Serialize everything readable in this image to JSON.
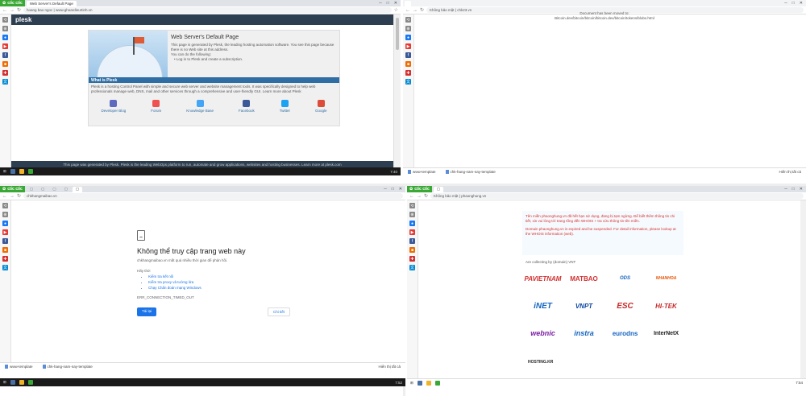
{
  "browser": {
    "brand": "cốc cốc"
  },
  "panel1": {
    "tab": "Web Server's Default Page",
    "address": "hoang bao ngoc | www.ghoardieurtinh.vn",
    "plesk_logo": "plesk",
    "title": "Web Server's Default Page",
    "description": "This page is generated by Plesk, the leading hosting automation software. You see this page because there is no Web site at this address.",
    "bullet_intro": "You can do the following:",
    "bullet": "Log in to Plesk and create a subscription.",
    "whatis_heading": "What is Plesk",
    "whatis_text": "Plesk is a hosting Control Panel with simple and secure web server and website management tools. It was specifically designed to help web professionals manage web, DNS, mail and other services through a comprehensive and user-friendly GUI. Learn more about Plesk",
    "links": [
      "Developer Blog",
      "Forum",
      "Knowledge Base",
      "Facebook",
      "Twitter",
      "Google"
    ],
    "footer": "This page was generated by Plesk. Plesk is the leading WebOps platform to run, automate and grow applications, websites and hosting businesses. Learn more at plesk.com",
    "taskbar_time": "7:40"
  },
  "panel2": {
    "tab": "",
    "address": "Không bảo mật | chk23.vn",
    "line1": "Document has been moved to:",
    "line2": "Bitcoin.dev/bitcoin/bitcoin/bitcoin.dev/bitcoin/tokens/blobs.html",
    "downloads": [
      "www-template",
      "chk-hang-nam-nay-template"
    ],
    "show_all": "Hiển thị tất cả"
  },
  "panel3": {
    "address": "chkhangmaibao.vn",
    "title": "Không thể truy cập trang web này",
    "subtitle": "chkhangmaibao.vn mất quá nhiều thời gian để phản hồi.",
    "try_label": "Hãy thử:",
    "suggestions": [
      "Kiểm tra kết nối",
      "Kiểm tra proxy và tường lửa",
      "Chạy Chẩn đoán mạng Windows"
    ],
    "error_code": "ERR_CONNECTION_TIMED_OUT",
    "reload": "Tải lại",
    "details": "Chi tiết",
    "downloads": [
      "www-template",
      "chk-hang-nam-nay-template"
    ],
    "show_all": "Hiển thị tất cả",
    "taskbar_time": "7:52"
  },
  "panel4": {
    "address": "Không bảo mật | phaonghung.vn",
    "notice_vi": "Tên miền phaonghung.vn đã hết hạn sử dụng, đang bị tạm ngừng. Để biết thêm thông tin chi tiết, xin vui lòng tới trang tống đến WHOIS + tra cứu thông tin tên miền.",
    "notice_en": "Domain phaonghung.vn is expired and be suspended. For detail information, please lookup at the WHOIS information (web).",
    "provided_by": "Are collecting by (domain) VNT",
    "logos": [
      "PAVIETNAM",
      "MATBAO",
      "ODS",
      "NHANHOA",
      "iNET",
      "VNPT",
      "ESC",
      "HI-TEK",
      "webnic",
      "instra",
      "eurodns",
      "InterNetX"
    ],
    "hosting": "HOSTING.KR",
    "taskbar_time": "7:54"
  },
  "colors": {
    "brand": "#3aa835",
    "plesk_dark": "#2c3e50",
    "plesk_blue": "#2f6ea5",
    "notice_red": "#d9302c",
    "link_blue": "#1a73e8"
  }
}
